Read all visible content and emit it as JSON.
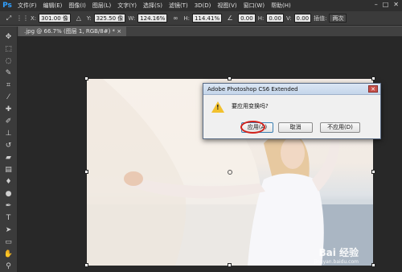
{
  "app": {
    "logo": "Ps"
  },
  "menu": [
    "文件(F)",
    "编辑(E)",
    "图像(I)",
    "图层(L)",
    "文字(Y)",
    "选择(S)",
    "滤镜(T)",
    "3D(D)",
    "视图(V)",
    "窗口(W)",
    "帮助(H)"
  ],
  "window_controls": {
    "minimize": "–",
    "restore": "□",
    "close": "✕"
  },
  "options_bar": {
    "x_label": "X:",
    "x_value": "301.00 像",
    "y_label": "Y:",
    "y_value": "325.50 像",
    "w_label": "W:",
    "w_value": "124.16%",
    "h_label": "H:",
    "h_value": "114.41%",
    "angle_value": "0.00",
    "hskew_label": "H:",
    "hskew_value": "0.00",
    "vskew_label": "V:",
    "vskew_value": "0.00",
    "interp_label": "插值:",
    "interp_value": "两次"
  },
  "document_tab": {
    "label": ".jpg @ 66.7% (图层 1, RGB/8#) *  ×"
  },
  "dialog": {
    "title": "Adobe Photoshop CS6 Extended",
    "close": "✕",
    "message": "要应用变换吗?",
    "buttons": {
      "apply": "应用(A)",
      "cancel": "取消",
      "dont_apply": "不应用(D)"
    }
  },
  "watermark": {
    "brand": "Bai 经验",
    "url": "jingyan.baidu.com"
  },
  "icons": {
    "tools": [
      "move-icon",
      "marquee-icon",
      "lasso-icon",
      "quick-select-icon",
      "crop-icon",
      "eyedropper-icon",
      "healing-icon",
      "brush-icon",
      "stamp-icon",
      "history-brush-icon",
      "eraser-icon",
      "gradient-icon",
      "blur-icon",
      "dodge-icon",
      "pen-icon",
      "type-icon",
      "path-select-icon",
      "shape-icon",
      "hand-icon",
      "zoom-icon"
    ]
  },
  "colors": {
    "accent": "#30a0ff",
    "warning": "#f2c12e",
    "highlight_circle": "#d2231c"
  }
}
